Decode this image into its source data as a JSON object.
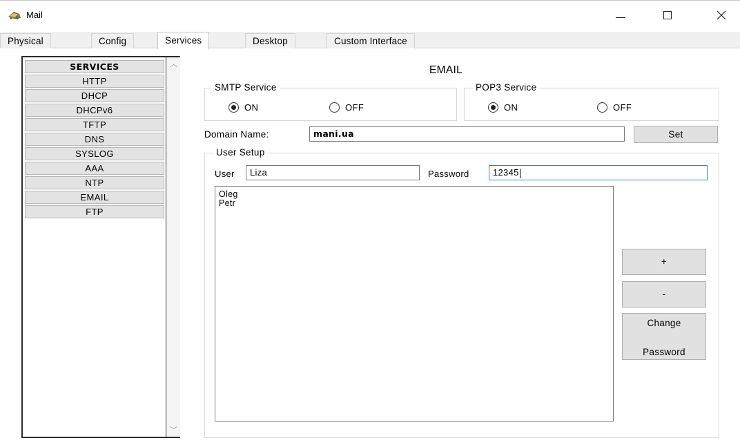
{
  "window": {
    "title": "Mail",
    "minimize_glyph": "—",
    "maximize_glyph": "☐",
    "close_glyph": "✕",
    "icon": "packet-tracer-mail-icon"
  },
  "tabs": [
    {
      "label": "Physical",
      "active": false
    },
    {
      "label": "Config",
      "active": false
    },
    {
      "label": "Services",
      "active": true
    },
    {
      "label": "Desktop",
      "active": false
    },
    {
      "label": "Custom Interface",
      "active": false
    }
  ],
  "services": {
    "header": "SERVICES",
    "items": [
      "HTTP",
      "DHCP",
      "DHCPv6",
      "TFTP",
      "DNS",
      "SYSLOG",
      "AAA",
      "NTP",
      "EMAIL",
      "FTP"
    ],
    "scroll_up": "︿",
    "scroll_down": "﹀"
  },
  "email": {
    "title": "EMAIL",
    "smtp": {
      "legend": "SMTP Service",
      "on_label": "ON",
      "off_label": "OFF",
      "selected": "ON"
    },
    "pop3": {
      "legend": "POP3 Service",
      "on_label": "ON",
      "off_label": "OFF",
      "selected": "ON"
    },
    "domain": {
      "label": "Domain Name:",
      "value": "mani.ua",
      "set_button": "Set"
    },
    "user_setup": {
      "legend": "User Setup",
      "user_label": "User",
      "user_value": "Liza",
      "password_label": "Password",
      "password_value": "12345",
      "users": [
        "Oleg",
        "Petr"
      ],
      "add_button": "+",
      "remove_button": "-",
      "change_password_line1": "Change",
      "change_password_line2": "Password"
    }
  }
}
